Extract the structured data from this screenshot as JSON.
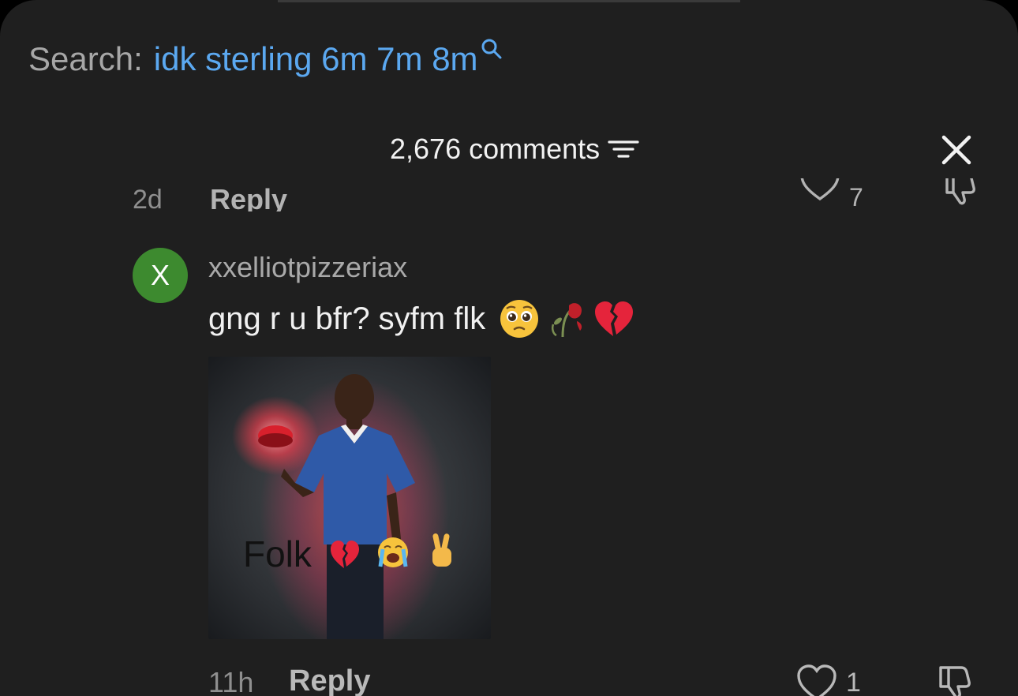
{
  "search": {
    "prefix": "Search:",
    "term": "idk sterling 6m 7m 8m"
  },
  "header": {
    "comment_count": "2,676 comments"
  },
  "previous_comment": {
    "time": "2d",
    "reply_label": "Reply",
    "like_count": "7"
  },
  "comment": {
    "avatar_letter": "X",
    "username": "xxelliotpizzeriax",
    "text": "gng r u bfr? syfm flk",
    "emojis": [
      "pleading-face",
      "wilted-rose",
      "broken-heart"
    ],
    "image": {
      "caption": "Folk",
      "caption_emojis": [
        "broken-heart",
        "loudly-crying-face",
        "victory-hand"
      ]
    },
    "time": "11h",
    "reply_label": "Reply",
    "like_count": "1"
  },
  "colors": {
    "sheet_bg": "#1f1f1f",
    "search_term": "#5ba8f0",
    "avatar_bg": "#3d8a2f"
  }
}
